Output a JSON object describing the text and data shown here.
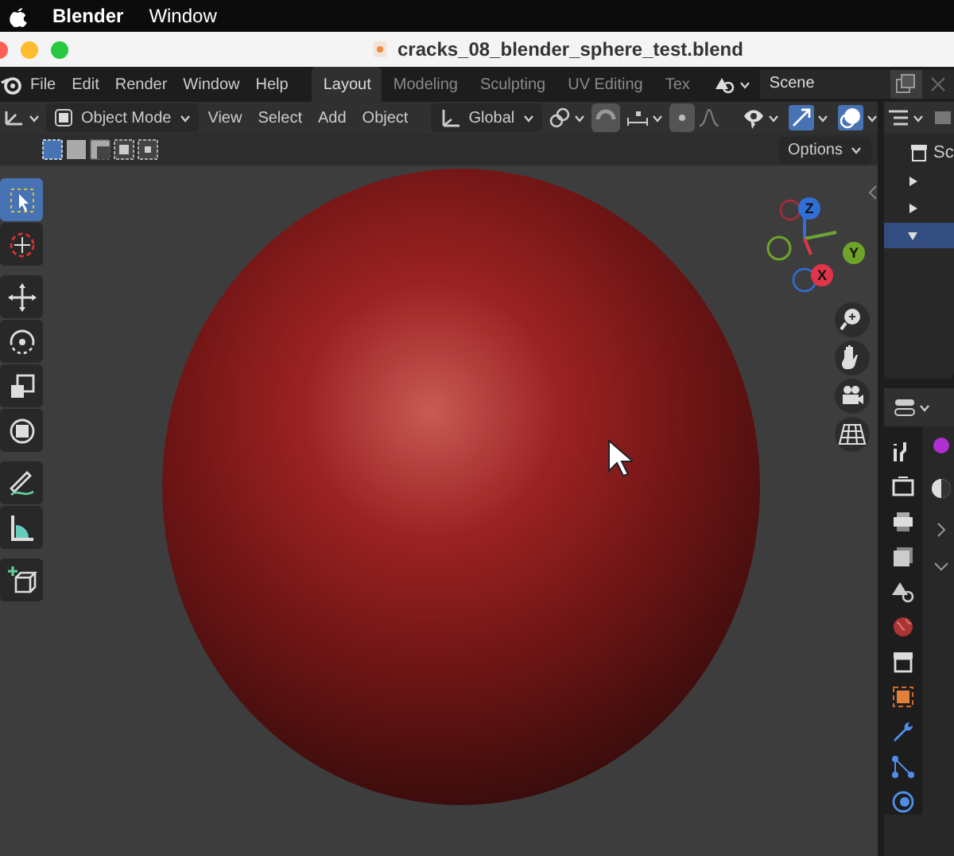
{
  "mac_menubar": {
    "app": "Blender",
    "menus": [
      "Window"
    ]
  },
  "window": {
    "title": "cracks_08_blender_sphere_test.blend"
  },
  "topbar": {
    "menus": [
      "File",
      "Edit",
      "Render",
      "Window",
      "Help"
    ],
    "workspaces": [
      {
        "label": "Layout",
        "selected": true
      },
      {
        "label": "Modeling",
        "selected": false
      },
      {
        "label": "Sculpting",
        "selected": false
      },
      {
        "label": "UV Editing",
        "selected": false
      },
      {
        "label": "Tex",
        "selected": false
      }
    ],
    "scene": "Scene"
  },
  "header": {
    "mode": "Object Mode",
    "menus": [
      "View",
      "Select",
      "Add",
      "Object"
    ],
    "orientation": "Global",
    "proportional_on": false,
    "snap_on": false,
    "overlays_on": true
  },
  "options": "Options",
  "tool_groups": [
    [
      {
        "kind": "select",
        "selected": true
      },
      {
        "kind": "cursor",
        "selected": false
      }
    ],
    [
      {
        "kind": "move",
        "selected": false
      },
      {
        "kind": "rotate",
        "selected": false
      },
      {
        "kind": "scale",
        "selected": false
      },
      {
        "kind": "transform",
        "selected": false
      }
    ],
    [
      {
        "kind": "annotate",
        "selected": false
      },
      {
        "kind": "measure",
        "selected": false
      }
    ],
    [
      {
        "kind": "add-cube",
        "selected": false
      }
    ]
  ],
  "gizmo": {
    "axes": [
      {
        "label": "Z",
        "color": "#2f6fd6"
      },
      {
        "label": "Y",
        "color": "#6fa32a"
      },
      {
        "label": "X",
        "color": "#e0344a"
      }
    ]
  },
  "outliner": {
    "root": "Sc",
    "rows": [
      {
        "expanded": false,
        "selected": false
      },
      {
        "expanded": false,
        "selected": false
      },
      {
        "expanded": true,
        "selected": true
      }
    ]
  },
  "properties_tabs": [
    {
      "kind": "tool"
    },
    {
      "kind": "render"
    },
    {
      "kind": "output"
    },
    {
      "kind": "view-layer"
    },
    {
      "kind": "scene"
    },
    {
      "kind": "world"
    },
    {
      "kind": "collection"
    },
    {
      "kind": "object"
    },
    {
      "kind": "modifier"
    },
    {
      "kind": "particles"
    },
    {
      "kind": "physics"
    }
  ]
}
